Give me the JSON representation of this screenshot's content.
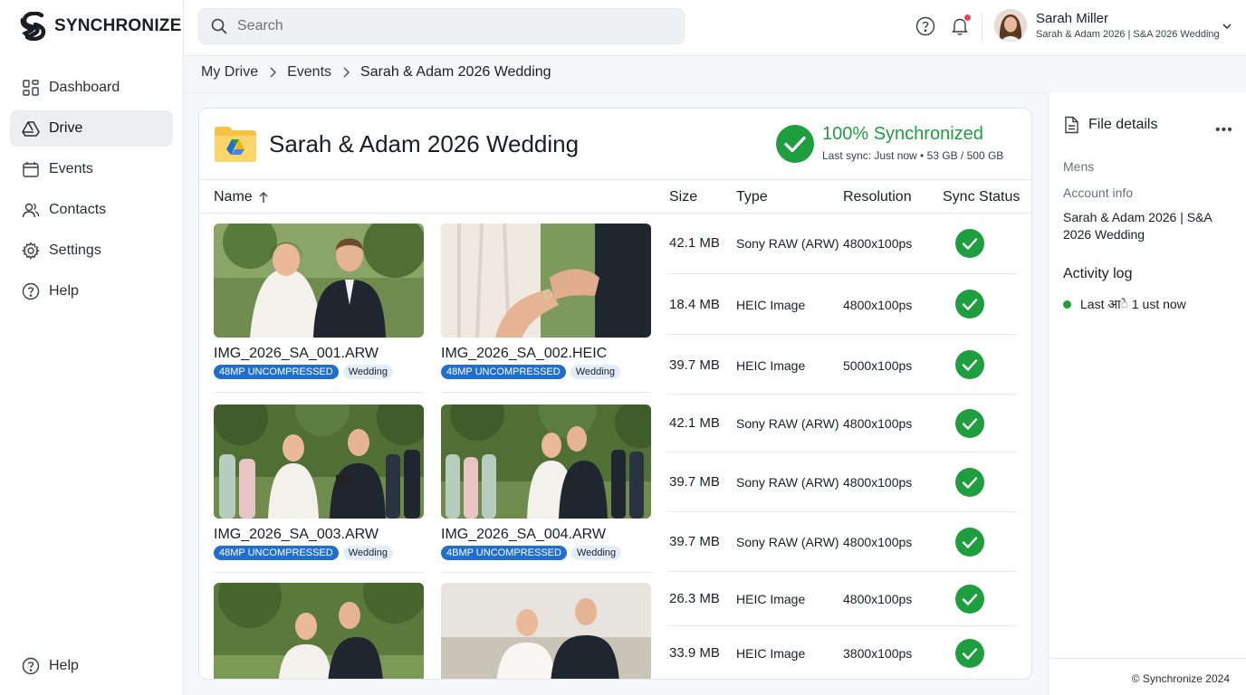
{
  "app": {
    "name": "SYNCHRONIZE"
  },
  "sidebar": {
    "items": [
      {
        "label": "Dashboard",
        "icon": "grid-icon"
      },
      {
        "label": "Drive",
        "icon": "drive-icon",
        "active": true
      },
      {
        "label": "Events",
        "icon": "calendar-icon"
      },
      {
        "label": "Contacts",
        "icon": "users-icon"
      },
      {
        "label": "Settings",
        "icon": "gear-icon"
      },
      {
        "label": "Help",
        "icon": "help-icon"
      }
    ],
    "bottom_help": "Help"
  },
  "search": {
    "placeholder": "Search"
  },
  "user": {
    "name": "Sarah Miller",
    "subtitle": "Sarah & Adam 2026 | S&A 2026 Wedding"
  },
  "breadcrumb": [
    "My Drive",
    "Events",
    "Sarah & Adam 2026 Wedding"
  ],
  "folder": {
    "title": "Sarah & Adam 2026 Wedding",
    "sync_title": "100% Synchronized",
    "sync_sub": "Last sync: Just now • 53 GB / 500 GB"
  },
  "table": {
    "headers": {
      "name": "Name",
      "size": "Size",
      "type": "Type",
      "resolution": "Resolution",
      "status": "Sync Status"
    },
    "tiles": [
      {
        "name": "IMG_2026_SA_001.ARW",
        "tag1": "48MP UNCOMPRESSED",
        "tag2": "Wedding"
      },
      {
        "name": "IMG_2026_SA_002.HEIC",
        "tag1": "48MP UNCOMPRESSED",
        "tag2": "Wedding"
      },
      {
        "name": "IMG_2026_SA_003.ARW",
        "tag1": "48MP UNCOMPRESSED",
        "tag2": "Wedding"
      },
      {
        "name": "IMG_2026_SA_004.ARW",
        "tag1": "4BMP UNCOMPRESSED",
        "tag2": "Wedding"
      }
    ],
    "rows": [
      {
        "size": "42.1 MB",
        "type": "Sony RAW (ARW)",
        "resolution": "4800x100ps"
      },
      {
        "size": "18.4 MB",
        "type": "HEIC Image",
        "resolution": "4800x100ps"
      },
      {
        "size": "39.7 MB",
        "type": "HEIC Image",
        "resolution": "5000x100ps"
      },
      {
        "size": "42.1 MB",
        "type": "Sony RAW (ARW)",
        "resolution": "4800x100ps"
      },
      {
        "size": "39.7 MB",
        "type": "Sony RAW (ARW)",
        "resolution": "4800x100ps"
      },
      {
        "size": "39.7 MB",
        "type": "Sony RAW (ARW)",
        "resolution": "4800x100ps"
      },
      {
        "size": "26.3 MB",
        "type": "HEIC Image",
        "resolution": "4800x100ps"
      },
      {
        "size": "33.9 MB",
        "type": "HEIC Image",
        "resolution": "3800x100ps"
      }
    ]
  },
  "details": {
    "title": "File details",
    "label1": "Mens",
    "label2": "Account info",
    "value": "Sarah & Adam 2026 | S&A 2026 Wedding",
    "activity_title": "Activity log",
    "activity_item": "Last आे 1 ust now",
    "footer": "© Synchronize 2024"
  },
  "colors": {
    "accent_green": "#1e9e3e",
    "tag_blue": "#1f6fd1",
    "notification": "#e5484d"
  }
}
